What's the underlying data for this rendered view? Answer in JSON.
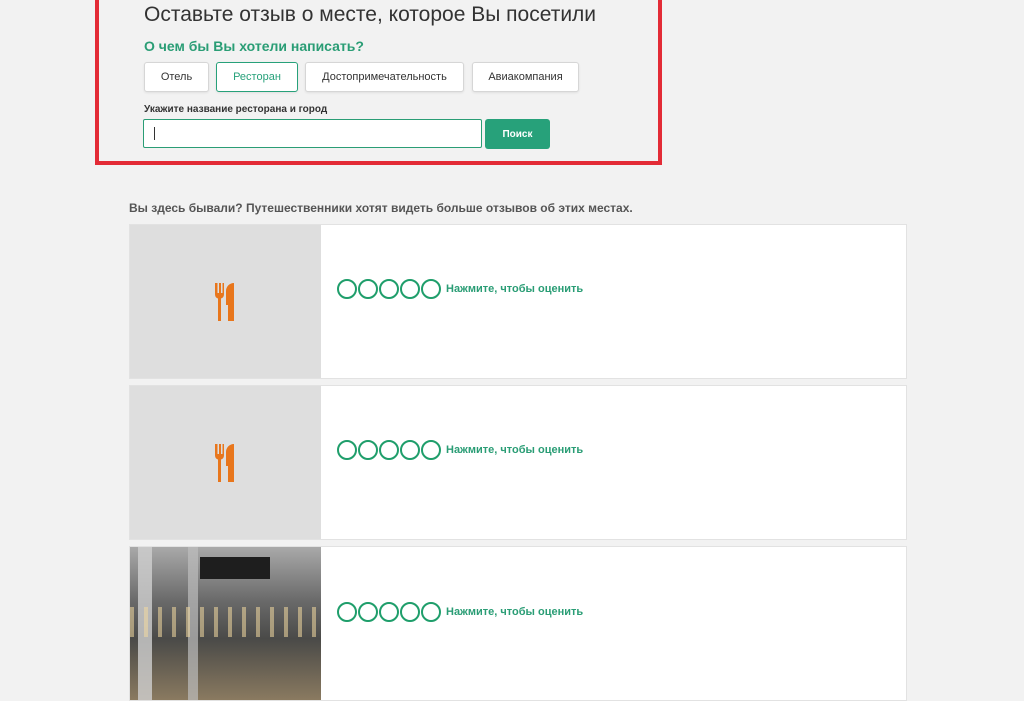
{
  "form": {
    "heading": "Оставьте отзыв о месте, которое Вы посетили",
    "subheading": "О чем бы Вы хотели написать?",
    "categories": [
      {
        "label": "Отель",
        "active": false
      },
      {
        "label": "Ресторан",
        "active": true
      },
      {
        "label": "Достопримечательность",
        "active": false
      },
      {
        "label": "Авиакомпания",
        "active": false
      }
    ],
    "field_label": "Укажите название ресторана и город",
    "search_value": "",
    "search_button": "Поиск"
  },
  "suggestions": {
    "prompt": "Вы здесь бывали? Путешественники хотят видеть больше отзывов об этих местах.",
    "cards": [
      {
        "thumb": "fork-knife-icon",
        "rating_label": "Нажмите, чтобы оценить",
        "bubbles": 5
      },
      {
        "thumb": "fork-knife-icon",
        "rating_label": "Нажмите, чтобы оценить",
        "bubbles": 5
      },
      {
        "thumb": "restaurant-photo",
        "rating_label": "Нажмите, чтобы оценить",
        "bubbles": 5
      }
    ]
  },
  "colors": {
    "accent": "#27a17a",
    "highlight": "#e32b36",
    "icon": "#e8761c"
  }
}
